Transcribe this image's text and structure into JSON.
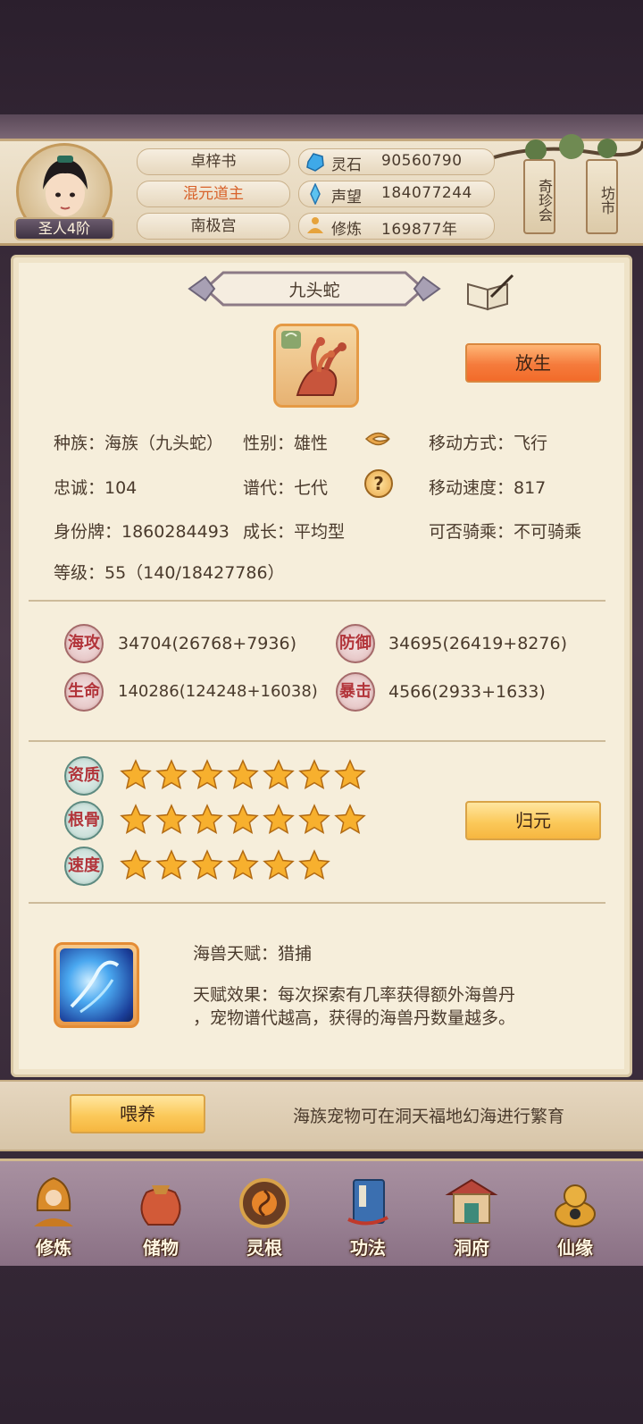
{
  "header": {
    "rank": "圣人4阶",
    "names": [
      "卓梓书",
      "混元道主",
      "南极宫"
    ],
    "resources": [
      {
        "icon": "spirit-stone-icon",
        "label": "灵石",
        "value": "90560790"
      },
      {
        "icon": "reputation-icon",
        "label": "声望",
        "value": "184077244"
      },
      {
        "icon": "cultivation-icon",
        "label": "修炼",
        "value": "169877年"
      }
    ],
    "side_buttons": [
      "奇珍会",
      "坊市"
    ]
  },
  "pet": {
    "name": "九头蛇",
    "release_button": "放生",
    "info": {
      "species": "种族：海族（九头蛇）",
      "gender": "性别：雄性",
      "move_type": "移动方式：飞行",
      "loyalty": "忠诚：104",
      "generation": "谱代：七代",
      "move_speed": "移动速度：817",
      "id_card": "身份牌：1860284493",
      "growth": "成长：平均型",
      "rideable": "可否骑乘：不可骑乘",
      "level": "等级：55（140/18427786）"
    },
    "stats": [
      {
        "label": "海攻",
        "value": "34704(26768+7936)"
      },
      {
        "label": "防御",
        "value": "34695(26419+8276)"
      },
      {
        "label": "生命",
        "value": "140286(124248+16038)"
      },
      {
        "label": "暴击",
        "value": "4566(2933+1633)"
      }
    ],
    "aptitudes": [
      {
        "label": "资质",
        "stars": 7
      },
      {
        "label": "根骨",
        "stars": 7
      },
      {
        "label": "速度",
        "stars": 6
      }
    ],
    "reset_button": "归元",
    "talent": {
      "name": "海兽天赋：猎捕",
      "effect_line1": "天赋效果：每次探索有几率获得额外海兽丹",
      "effect_line2": "，宠物谱代越高，获得的海兽丹数量越多。"
    }
  },
  "feed": {
    "button": "喂养",
    "note": "海族宠物可在洞天福地幻海进行繁育"
  },
  "nav": [
    {
      "label": "修炼",
      "icon": "cultivate-icon"
    },
    {
      "label": "储物",
      "icon": "storage-bag-icon"
    },
    {
      "label": "灵根",
      "icon": "spirit-root-icon"
    },
    {
      "label": "功法",
      "icon": "technique-book-icon"
    },
    {
      "label": "洞府",
      "icon": "cave-mansion-icon"
    },
    {
      "label": "仙缘",
      "icon": "immortal-fate-icon"
    }
  ],
  "colors": {
    "accent_orange": "#f57b3c",
    "accent_yellow": "#fbc95a",
    "stat_red": "#b2343a"
  }
}
